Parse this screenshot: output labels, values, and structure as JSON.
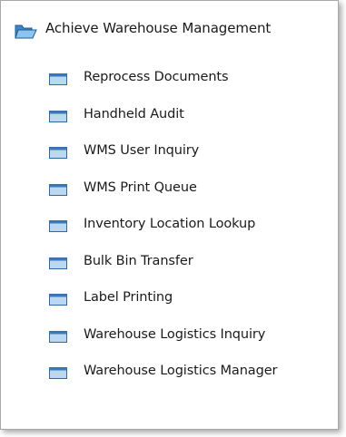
{
  "menu": {
    "title": "Achieve Warehouse Management",
    "items": [
      {
        "label": "Reprocess Documents"
      },
      {
        "label": "Handheld Audit"
      },
      {
        "label": "WMS User Inquiry"
      },
      {
        "label": "WMS Print Queue"
      },
      {
        "label": "Inventory Location Lookup"
      },
      {
        "label": "Bulk Bin Transfer"
      },
      {
        "label": "Label Printing"
      },
      {
        "label": "Warehouse Logistics Inquiry"
      },
      {
        "label": "Warehouse Logistics Manager"
      }
    ]
  },
  "icons": {
    "header": "open-folder-icon",
    "item": "window-icon"
  },
  "colors": {
    "folder_fill": "#5aa6e0",
    "window_title": "#3a78b8",
    "window_body": "#bcd8f0"
  }
}
